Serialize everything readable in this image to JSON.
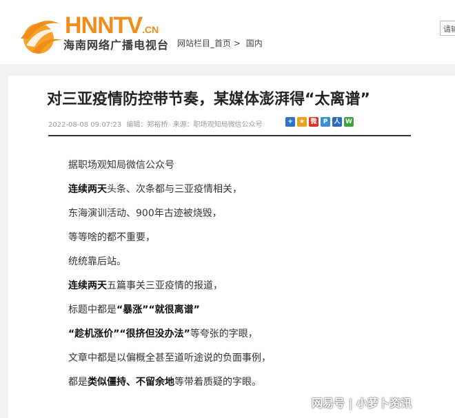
{
  "header": {
    "logo_text": "HNNTV",
    "logo_suffix": ".CN",
    "station_name": "海南网络广播电视台",
    "breadcrumb": {
      "root": "网站栏目_首页",
      "separator": ">",
      "current": "国内"
    },
    "search_hint": "请输"
  },
  "article": {
    "title": "对三亚疫情防控带节奏，某媒体澎湃得“太离谱”",
    "meta": {
      "datetime": "2022-08-08 09:07:23",
      "editor": "编辑：郑裕桥",
      "source": "来源：职场观知局微信公众号"
    },
    "share_icons": [
      {
        "name": "share-add-icon",
        "glyph": "+",
        "color": "#2e73c8"
      },
      {
        "name": "share-qzone-icon",
        "glyph": "★",
        "color": "#e8a21c"
      },
      {
        "name": "share-weibo-icon",
        "glyph": "微",
        "color": "#d9352c"
      },
      {
        "name": "share-pengyou-icon",
        "glyph": "P",
        "color": "#3a8ed8"
      },
      {
        "name": "share-renren-icon",
        "glyph": "人",
        "color": "#2c6bb5"
      },
      {
        "name": "share-wechat-icon",
        "glyph": "W",
        "color": "#3aa63a"
      }
    ],
    "paragraphs": [
      {
        "bold": "",
        "text": "据职场观知局微信公众号"
      },
      {
        "bold": "连续两天",
        "text": "头条、次条都与三亚疫情相关，"
      },
      {
        "bold": "",
        "text": "东海演训活动、900年古迹被烧毁，"
      },
      {
        "bold": "",
        "text": "等等啥的都不重要，"
      },
      {
        "bold": "",
        "text": "统统靠后站。"
      },
      {
        "bold": "连续两天",
        "text": "五篇事关三亚疫情的报道，"
      }
    ],
    "para7": {
      "pre": "标题中都是",
      "b1": "“暴涨”",
      "mid": "",
      "b2": "“就很离谱”"
    },
    "para8": {
      "b1": "“趁机涨价”",
      "b2": "“很挤但没办法”",
      "post": "等夸张的字眼，"
    },
    "para9": "文章中都是以偏概全甚至道听途说的负面事例，",
    "para10": {
      "pre": "都是",
      "b1": "类似僵持、不留余地",
      "post": "等带着质疑的字眼。"
    }
  },
  "watermark": "网易号 | 小萝卜资讯"
}
